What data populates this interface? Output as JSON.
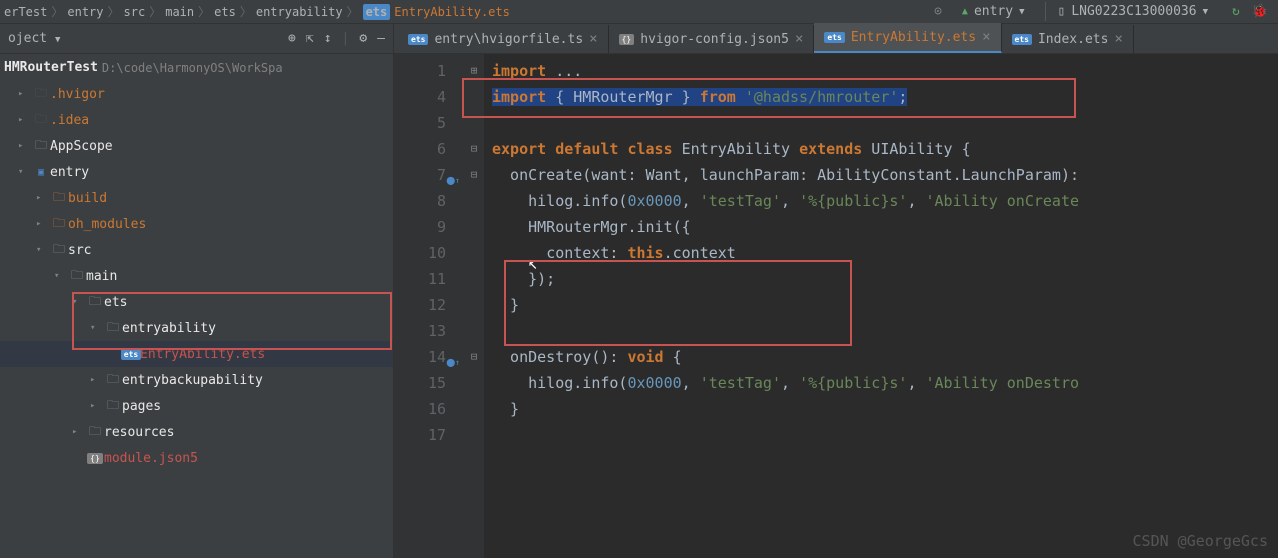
{
  "breadcrumb": {
    "items": [
      "erTest",
      "entry",
      "src",
      "main",
      "ets",
      "entryability"
    ],
    "activeFile": "EntryAbility.ets"
  },
  "toolbar": {
    "configName": "entry",
    "deviceName": "LNG0223C13000036"
  },
  "sidebar": {
    "headerLabel": "oject",
    "project": {
      "name": "HMRouterTest",
      "path": "D:\\code\\HarmonyOS\\WorkSpa"
    },
    "tree": [
      {
        "label": ".hvigor",
        "style": "orange",
        "indent": 1,
        "arrow": ">",
        "iconType": "folder-dark"
      },
      {
        "label": ".idea",
        "style": "orange",
        "indent": 1,
        "arrow": ">",
        "iconType": "folder-dark"
      },
      {
        "label": "AppScope",
        "style": "white",
        "indent": 1,
        "arrow": ">",
        "iconType": "folder"
      },
      {
        "label": "entry",
        "style": "white",
        "indent": 1,
        "arrow": "v",
        "iconType": "module"
      },
      {
        "label": "build",
        "style": "orange",
        "indent": 2,
        "arrow": ">",
        "iconType": "folder-orange"
      },
      {
        "label": "oh_modules",
        "style": "orange",
        "indent": 2,
        "arrow": ">",
        "iconType": "folder-orange"
      },
      {
        "label": "src",
        "style": "white",
        "indent": 2,
        "arrow": "v",
        "iconType": "folder"
      },
      {
        "label": "main",
        "style": "white",
        "indent": 3,
        "arrow": "v",
        "iconType": "folder"
      },
      {
        "label": "ets",
        "style": "white",
        "indent": 4,
        "arrow": "v",
        "iconType": "folder"
      },
      {
        "label": "entryability",
        "style": "white",
        "indent": 5,
        "arrow": "v",
        "iconType": "folder",
        "highlight": true
      },
      {
        "label": "EntryAbility.ets",
        "style": "red",
        "indent": 6,
        "arrow": "",
        "iconType": "ets",
        "selected": true
      },
      {
        "label": "entrybackupability",
        "style": "white",
        "indent": 5,
        "arrow": ">",
        "iconType": "folder"
      },
      {
        "label": "pages",
        "style": "white",
        "indent": 5,
        "arrow": ">",
        "iconType": "folder"
      },
      {
        "label": "resources",
        "style": "white",
        "indent": 4,
        "arrow": ">",
        "iconType": "folder"
      },
      {
        "label": "module.json5",
        "style": "red",
        "indent": 4,
        "arrow": "",
        "iconType": "json5"
      }
    ]
  },
  "tabs": [
    {
      "label": "entry\\hvigorfile.ts",
      "active": false,
      "badge": "ets",
      "badgeColor": "blue"
    },
    {
      "label": "hvigor-config.json5",
      "active": false,
      "badge": "{} ",
      "badgeColor": "gray"
    },
    {
      "label": "EntryAbility.ets",
      "active": true,
      "badge": "ets",
      "badgeColor": "blue"
    },
    {
      "label": "Index.ets",
      "active": false,
      "badge": "ets",
      "badgeColor": "blue"
    }
  ],
  "code": {
    "lines": [
      {
        "num": "1",
        "fold": "+",
        "html": "<span class='kw'>import</span> ..."
      },
      {
        "num": "4",
        "fold": "",
        "html": "<span class='sel'><span class='kw'>import</span> { HMRouterMgr } <span class='kw'>from</span> <span class='str'>'@hadss/hmrouter'</span>;</span>"
      },
      {
        "num": "5",
        "fold": "",
        "html": ""
      },
      {
        "num": "6",
        "fold": "-",
        "html": "<span class='kw'>export default class</span> EntryAbility <span class='kw'>extends</span> UIAbility {"
      },
      {
        "num": "7",
        "fold": "-",
        "mark": "o↑",
        "html": "  onCreate(<span class='param'>want</span>: Want, <span class='param'>launchParam</span>: AbilityConstant.LaunchParam):"
      },
      {
        "num": "8",
        "fold": "",
        "html": "    hilog.info(<span class='num'>0x0000</span>, <span class='str'>'testTag'</span>, <span class='str'>'%{public}s'</span>, <span class='str'>'Ability onCreate</span>"
      },
      {
        "num": "9",
        "fold": "",
        "html": "    HMRouterMgr.init({"
      },
      {
        "num": "10",
        "fold": "",
        "html": "      <span class='param'>context</span>: <span class='kw'>this</span>.context"
      },
      {
        "num": "11",
        "fold": "",
        "html": "    });"
      },
      {
        "num": "12",
        "fold": "",
        "html": "  }"
      },
      {
        "num": "13",
        "fold": "",
        "html": ""
      },
      {
        "num": "14",
        "fold": "-",
        "mark": "o↑",
        "html": "  onDestroy(): <span class='kw'>void</span> {"
      },
      {
        "num": "15",
        "fold": "",
        "html": "    hilog.info(<span class='num'>0x0000</span>, <span class='str'>'testTag'</span>, <span class='str'>'%{public}s'</span>, <span class='str'>'Ability onDestro</span>"
      },
      {
        "num": "16",
        "fold": "",
        "html": "  }"
      },
      {
        "num": "17",
        "fold": "",
        "html": ""
      }
    ]
  },
  "watermark": "CSDN @GeorgeGcs"
}
